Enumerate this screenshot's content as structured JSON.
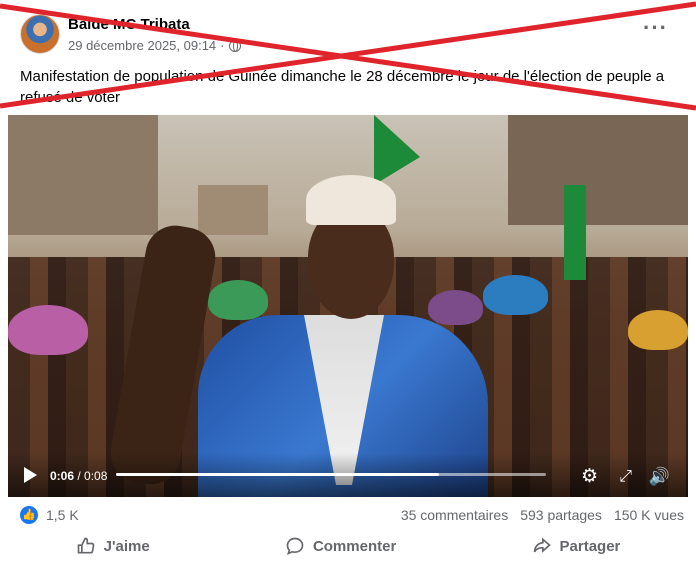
{
  "post": {
    "author": "Balde MC Tribata",
    "date": "29 décembre 2025, 09:14",
    "separator": "·",
    "caption": "Manifestation de population de Guinée dimanche le 28 décembre le jour de l'élection de peuple a refusé de voter",
    "more_icon": "···"
  },
  "video": {
    "current_time": "0:06",
    "total_time": "/ 0:08",
    "progress": 0.75
  },
  "stats": {
    "reactions": "1,5 K",
    "comments": "35 commentaires",
    "shares": "593 partages",
    "views": "150 K vues"
  },
  "actions": {
    "like": "J'aime",
    "comment": "Commenter",
    "share": "Partager"
  },
  "colors": {
    "cross": "#e0242b",
    "accent": "#1877f2",
    "secondary_text": "#65676b"
  }
}
